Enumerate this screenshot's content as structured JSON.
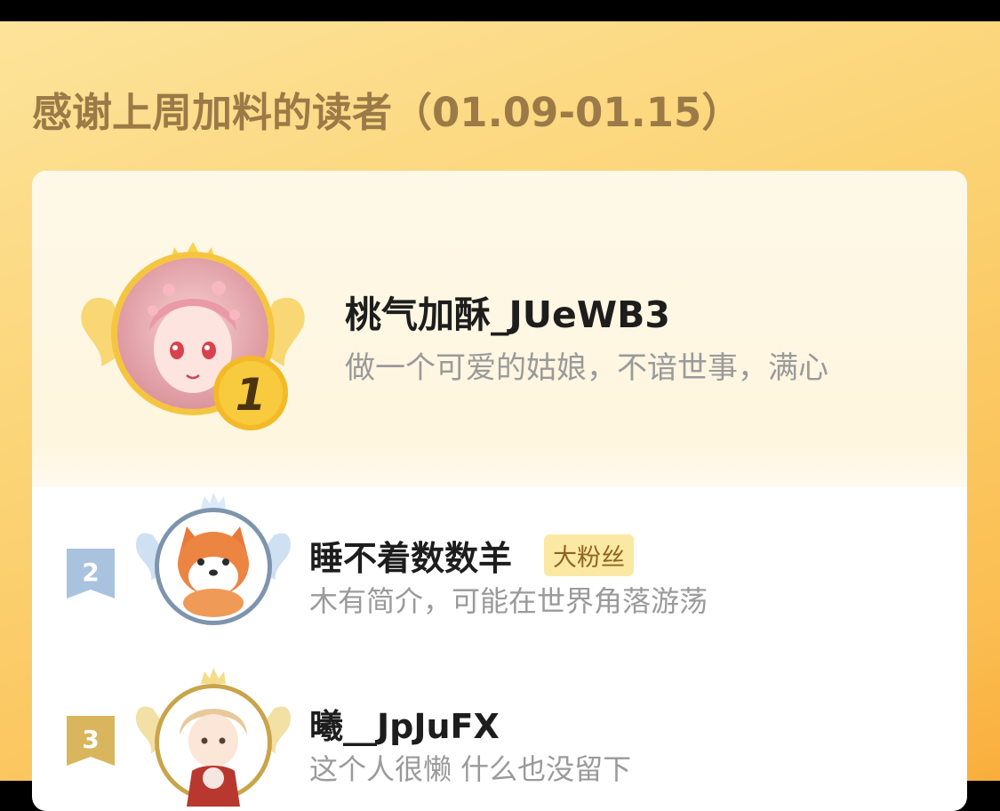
{
  "header": {
    "title": "感谢上周加料的读者（01.09-01.15）"
  },
  "ranking": [
    {
      "rank": "1",
      "name": "桃气加酥_JUeWB3",
      "bio": "做一个可爱的姑娘，不谙世事，满心",
      "badge": "",
      "avatar_icon": "anime-girl-avatar"
    },
    {
      "rank": "2",
      "name": "睡不着数数羊",
      "bio": "木有简介，可能在世界角落游荡",
      "badge": "大粉丝",
      "avatar_icon": "shiba-dog-avatar"
    },
    {
      "rank": "3",
      "name": "曦__JpJuFX",
      "bio": "这个人很懒 什么也没留下",
      "badge": "",
      "avatar_icon": "anime-boy-avatar"
    }
  ],
  "colors": {
    "gold": "#f6c133",
    "silver": "#a9c0da",
    "bronze": "#d6b25a",
    "title": "#9b7a47"
  }
}
